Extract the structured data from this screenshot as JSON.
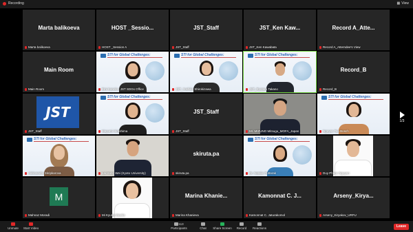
{
  "topbar": {
    "recording": "Recording",
    "view": "View"
  },
  "nav": {
    "page": "1/3"
  },
  "tiles": [
    {
      "big": "Marta balikoeva",
      "name": "Marta balikoeva"
    },
    {
      "big": "HOST _Sessio...",
      "name": "HOST _Session A"
    },
    {
      "big": "JST_Staff",
      "name": "JST_Staff"
    },
    {
      "big": "JST_Ken Kaw...",
      "name": "JST_Ken Kawabata"
    },
    {
      "big": "Record A_Atte...",
      "name": "Record A_Atterndee's View"
    },
    {
      "big": "Main Room",
      "name": "Main Room"
    },
    {
      "big": "",
      "name": "Emi Kaneko, JST SDGs Office"
    },
    {
      "big": "",
      "name": "JST_Yoshiko Shirokizawa"
    },
    {
      "big": "",
      "name": "JST_Ryotaro Takano"
    },
    {
      "big": "Record_B",
      "name": "Record_B"
    },
    {
      "big": "",
      "name": "JST_Staff"
    },
    {
      "big": "",
      "name": "Mayumi Hirashima"
    },
    {
      "big": "JST_Staff",
      "name": "JST_Staff"
    },
    {
      "big": "",
      "name": "Mr. MIZUNO Mitsugu_MOFA_Japan"
    },
    {
      "big": "",
      "name": "Nguyen Tan Bosch"
    },
    {
      "big": "",
      "name": "Aleksandra Skripkarova"
    },
    {
      "big": "",
      "name": "Lai Hung Wei (Kyoto University)"
    },
    {
      "big": "skiruta.pa",
      "name": "skiruta.pa"
    },
    {
      "big": "",
      "name": "Dr. Natalie Puttarak"
    },
    {
      "big": "",
      "name": "Duy Phuoc Nguyen"
    },
    {
      "big": "",
      "name": "Mahnaz Moradi"
    },
    {
      "big": "",
      "name": "Mi Kyung Weeks"
    },
    {
      "big": "Marina Khanie...",
      "name": "Marina Khanieva"
    },
    {
      "big": "Kamonnat C. J...",
      "name": "Kamonnat C. Jaturakomol"
    },
    {
      "big": "Arseny_Kirya...",
      "name": "Arseny_Kiryakov_URFU"
    }
  ],
  "slide": {
    "title": "STI for Global Challenges:"
  },
  "jst_logo": "JST",
  "m_avatar": "M",
  "bottombar": {
    "unmute": "Unmute",
    "start_video": "Start Video",
    "participants": "Participants",
    "participants_count": "113",
    "chat": "Chat",
    "share": "Share Screen",
    "record": "Record",
    "reactions": "Reactions",
    "leave": "Leave"
  }
}
